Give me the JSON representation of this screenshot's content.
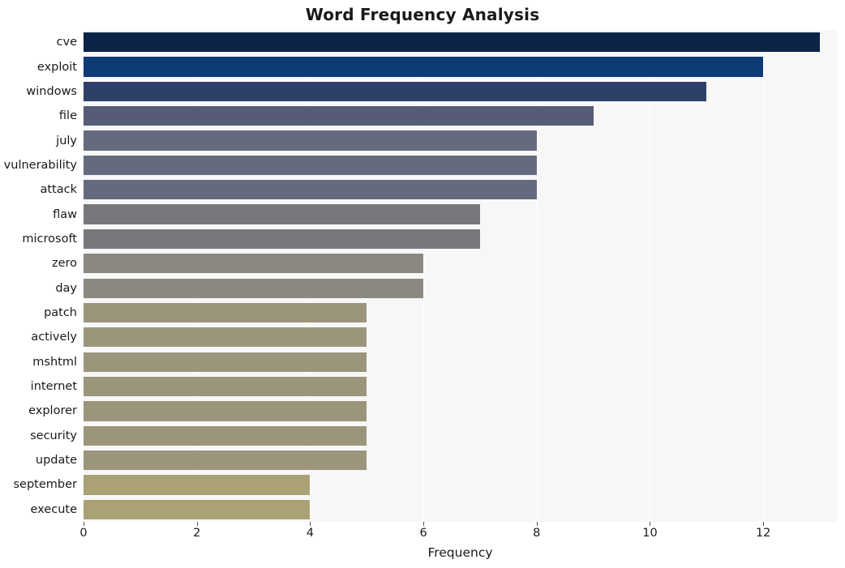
{
  "chart_data": {
    "type": "bar",
    "orientation": "horizontal",
    "title": "Word Frequency Analysis",
    "xlabel": "Frequency",
    "ylabel": "",
    "xlim": [
      0,
      13.3
    ],
    "xticks": [
      0,
      2,
      4,
      6,
      8,
      10,
      12
    ],
    "grid": "vertical",
    "legend": "none",
    "categories": [
      "cve",
      "exploit",
      "windows",
      "file",
      "july",
      "vulnerability",
      "attack",
      "flaw",
      "microsoft",
      "zero",
      "day",
      "patch",
      "actively",
      "mshtml",
      "internet",
      "explorer",
      "security",
      "update",
      "september",
      "execute"
    ],
    "values": [
      13,
      12,
      11,
      9,
      8,
      8,
      8,
      7,
      7,
      6,
      6,
      5,
      5,
      5,
      5,
      5,
      5,
      5,
      4,
      4
    ],
    "bar_colors": [
      "#0b2447",
      "#0d3b75",
      "#2e4069",
      "#565b78",
      "#666a7f",
      "#666a7f",
      "#666a7f",
      "#77787c",
      "#77787c",
      "#8b8882",
      "#8b8882",
      "#9b957c",
      "#9b957c",
      "#9b957c",
      "#9b957c",
      "#9b957c",
      "#9b957c",
      "#9b957c",
      "#aaa274",
      "#aaa274"
    ],
    "plot_background": "#f7f7f7",
    "figure_background": "#ffffff",
    "gridline_color": "#ffffff"
  }
}
